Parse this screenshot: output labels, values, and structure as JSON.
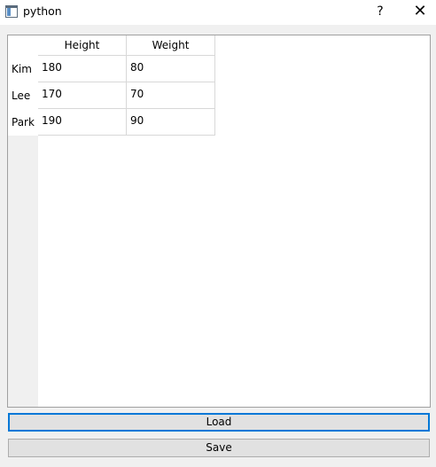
{
  "window": {
    "title": "python",
    "help_label": "?",
    "close_label": "✕"
  },
  "table": {
    "columns": [
      "Height",
      "Weight"
    ],
    "rows": [
      {
        "header": "Kim",
        "cells": [
          "180",
          "80"
        ]
      },
      {
        "header": "Lee",
        "cells": [
          "170",
          "70"
        ]
      },
      {
        "header": "Park",
        "cells": [
          "190",
          "90"
        ]
      }
    ]
  },
  "buttons": {
    "load_label": "Load",
    "save_label": "Save"
  },
  "colors": {
    "focus_border": "#0078d7",
    "button_bg": "#e1e1e1"
  }
}
